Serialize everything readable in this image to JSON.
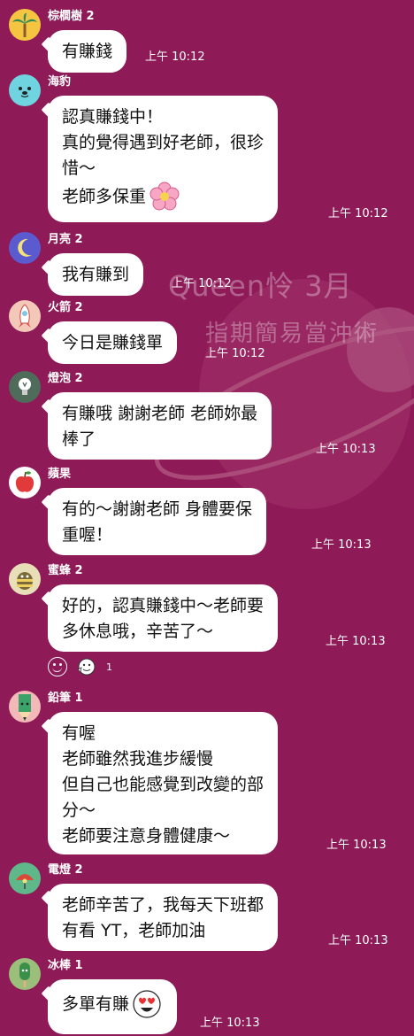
{
  "watermark": {
    "line1": "Queen怜  3月",
    "line2": "指期簡易當沖術"
  },
  "messages": [
    {
      "name": "棕櫚樹 2",
      "avatar": "palm-tree-icon",
      "lines": [
        "有賺錢"
      ],
      "time": "上午 10:12"
    },
    {
      "name": "海豹",
      "avatar": "seal-icon",
      "lines": [
        "認真賺錢中！",
        "真的覺得遇到好老師，很珍",
        "惜～",
        "老師多保重"
      ],
      "emoji": "flower-emoji",
      "time": "上午 10:12"
    },
    {
      "name": "月亮 2",
      "avatar": "moon-icon",
      "lines": [
        "我有賺到"
      ],
      "time": "上午 10:12"
    },
    {
      "name": "火箭 2",
      "avatar": "rocket-icon",
      "lines": [
        "今日是賺錢單"
      ],
      "time": "上午 10:12"
    },
    {
      "name": "燈泡 2",
      "avatar": "lightbulb-icon",
      "lines": [
        "有賺哦 謝謝老師 老師妳最",
        "棒了"
      ],
      "time": "上午 10:13"
    },
    {
      "name": "蘋果",
      "avatar": "apple-icon",
      "lines": [
        "有的～謝謝老師 身體要保",
        "重喔！"
      ],
      "time": "上午 10:13"
    },
    {
      "name": "蜜蜂 2",
      "avatar": "bee-icon",
      "lines": [
        "好的，認真賺錢中～老師要",
        "多休息哦，辛苦了～"
      ],
      "time": "上午 10:13"
    },
    {
      "name": "鉛筆 1",
      "avatar": "pencil-icon",
      "lines": [
        "有喔",
        "老師雖然我進步緩慢",
        "但自己也能感覺到改變的部",
        "分～",
        "老師要注意身體健康～"
      ],
      "time": "上午 10:13"
    },
    {
      "name": "電燈 2",
      "avatar": "lamp-icon",
      "lines": [
        "老師辛苦了，我每天下班都",
        "有看 YT，老師加油"
      ],
      "time": "上午 10:13"
    },
    {
      "name": "冰棒 1",
      "avatar": "popsicle-icon",
      "lines": [
        "多單有賺"
      ],
      "emoji": "heart-eyes-emoji",
      "time": "上午 10:13"
    }
  ],
  "reaction": {
    "count": "1"
  }
}
